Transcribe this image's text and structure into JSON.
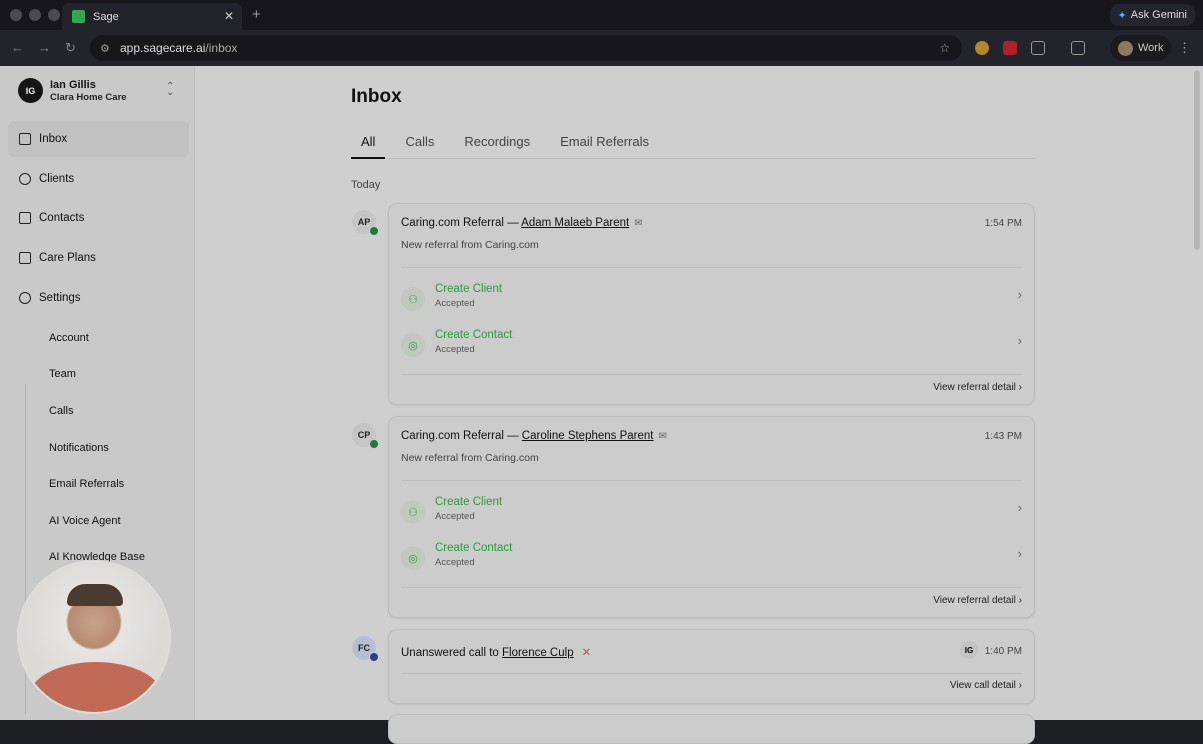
{
  "browser": {
    "tab_title": "Sage",
    "url_host": "app.sagecare.ai",
    "url_path": "/inbox",
    "gemini": "Ask Gemini",
    "profile": "Work"
  },
  "user": {
    "initials": "IG",
    "name": "Ian Gillis",
    "org": "Clara Home Care"
  },
  "sidebar": {
    "items": [
      {
        "label": "Inbox",
        "icon": "inbox-icon"
      },
      {
        "label": "Clients",
        "icon": "users-icon"
      },
      {
        "label": "Contacts",
        "icon": "contacts-icon"
      },
      {
        "label": "Care Plans",
        "icon": "clipboard-icon"
      },
      {
        "label": "Settings",
        "icon": "gear-icon"
      }
    ],
    "settings_sub": [
      "Account",
      "Team",
      "Calls",
      "Notifications",
      "Email Referrals",
      "AI Voice Agent",
      "AI Knowledge Base"
    ]
  },
  "main": {
    "title": "Inbox",
    "tabs": [
      "All",
      "Calls",
      "Recordings",
      "Email Referrals"
    ],
    "section": "Today",
    "cards": [
      {
        "initials": "AP",
        "title": "Caring.com Referral — ",
        "link": "Adam Malaeb Parent",
        "time": "1:54 PM",
        "subtitle": "New referral from Caring.com",
        "actions": [
          {
            "name": "Create Client",
            "status": "Accepted"
          },
          {
            "name": "Create Contact",
            "status": "Accepted"
          }
        ],
        "footer": "View referral detail"
      },
      {
        "initials": "CP",
        "title": "Caring.com Referral — ",
        "link": "Caroline Stephens Parent",
        "time": "1:43 PM",
        "subtitle": "New referral from Caring.com",
        "actions": [
          {
            "name": "Create Client",
            "status": "Accepted"
          },
          {
            "name": "Create Contact",
            "status": "Accepted"
          }
        ],
        "footer": "View referral detail"
      },
      {
        "initials": "FC",
        "title": "Unanswered call to ",
        "link": "Florence Culp",
        "time": "1:40 PM",
        "agent": "IG",
        "footer": "View call detail"
      }
    ]
  },
  "colors": {
    "accent_green": "#2c9a3f",
    "missed_red": "#c9485b"
  }
}
